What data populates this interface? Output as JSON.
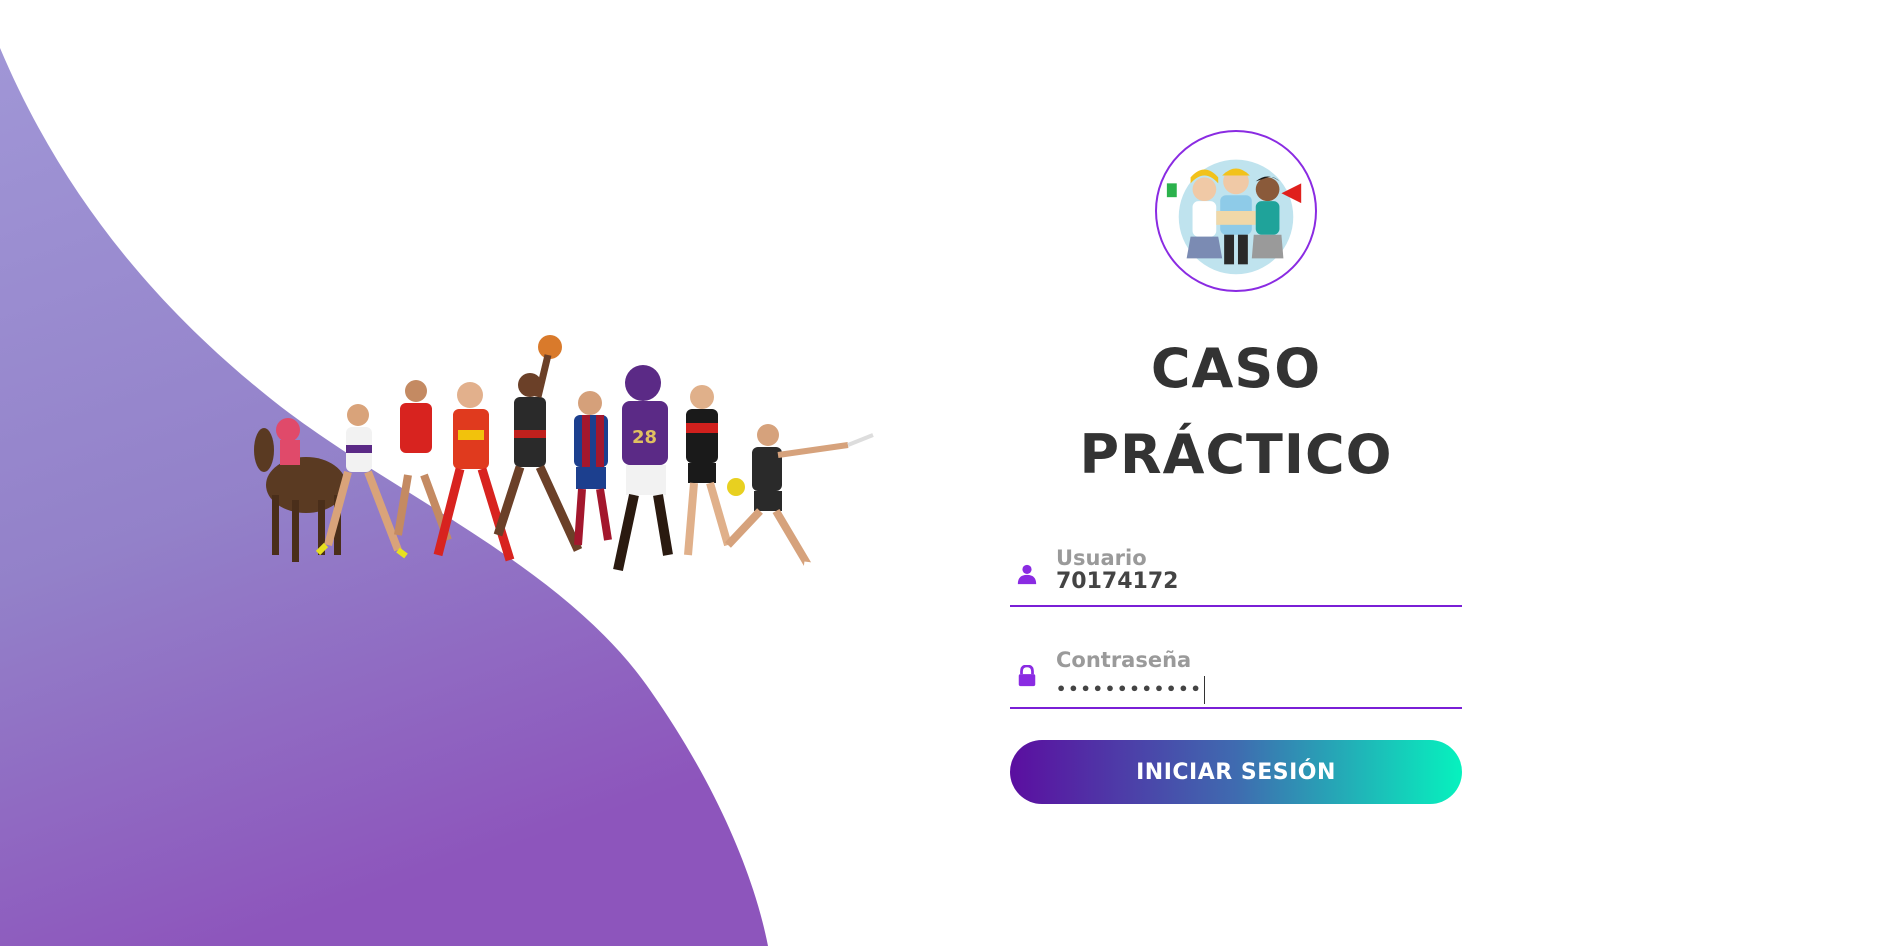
{
  "brand": {
    "title_line1": "CASO",
    "title_line2": "PRÁCTICO",
    "logo_icon": "team-avatar-icon",
    "accent_color": "#8a2be2"
  },
  "login": {
    "username": {
      "label": "Usuario",
      "value": "70174172",
      "icon": "user-icon"
    },
    "password": {
      "label": "Contraseña",
      "value": "••••••••••••",
      "icon": "lock-icon"
    },
    "submit_label": "INICIAR SESIÓN"
  },
  "decor": {
    "wave_color_top": "#9b8bd0",
    "wave_color_bottom": "#8e56bd",
    "illustration": "sports-athletes-illustration"
  }
}
